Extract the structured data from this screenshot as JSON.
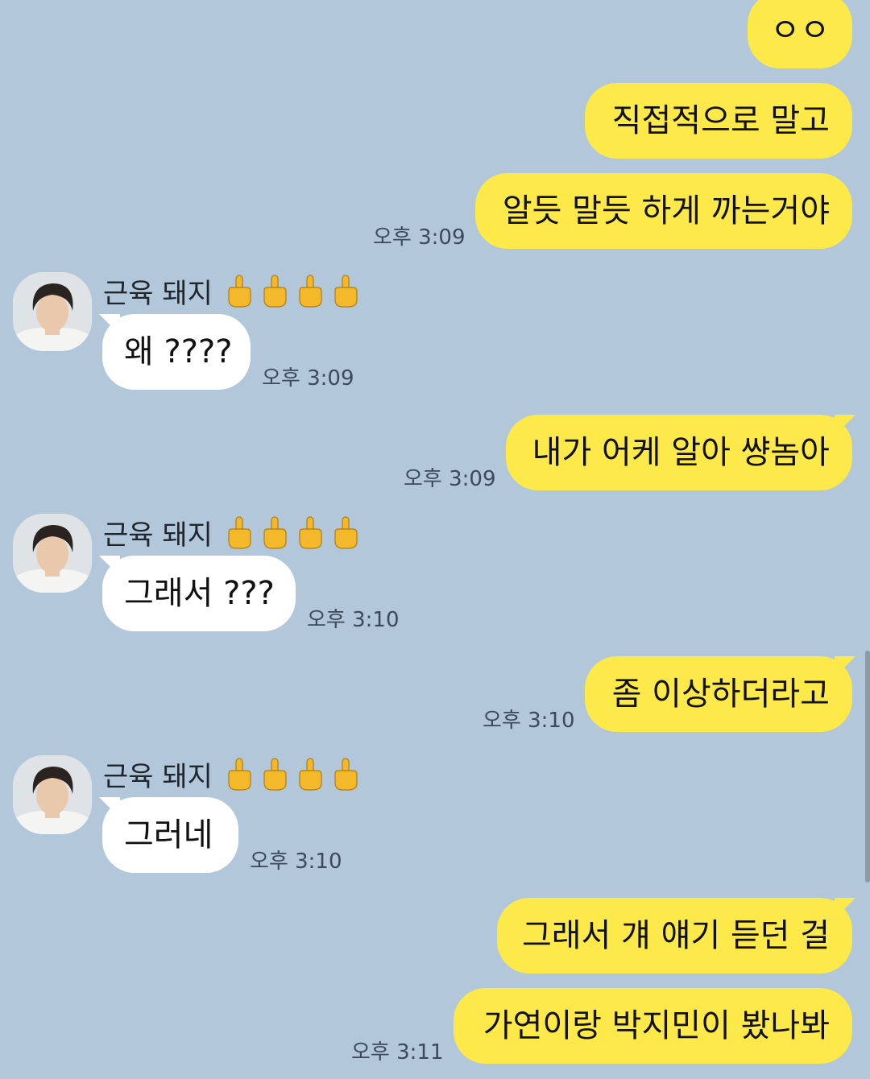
{
  "colors": {
    "background": "#b2c7da",
    "my_bubble": "#fee94a",
    "their_bubble": "#ffffff",
    "timestamp_text": "#3b4a5a"
  },
  "contact": {
    "name": "근육 돼지",
    "name_icons": [
      "middle-finger-icon",
      "middle-finger-icon",
      "middle-finger-icon",
      "middle-finger-icon"
    ]
  },
  "messages": [
    {
      "from": "me",
      "text": "ㅇㅇ"
    },
    {
      "from": "me",
      "text": "직접적으로 말고"
    },
    {
      "from": "me",
      "text": "알듯 말듯 하게 까는거야",
      "time": "오후 3:09"
    },
    {
      "from": "them",
      "text": "왜 ????",
      "time": "오후 3:09"
    },
    {
      "from": "me",
      "text": "내가 어케 알아 썅놈아",
      "time": "오후 3:09"
    },
    {
      "from": "them",
      "text": "그래서 ???",
      "time": "오후 3:10"
    },
    {
      "from": "me",
      "text": "좀 이상하더라고",
      "time": "오후 3:10"
    },
    {
      "from": "them",
      "text": "그러네",
      "time": "오후 3:10"
    },
    {
      "from": "me",
      "text": "그래서 걔 얘기 듣던 걸"
    },
    {
      "from": "me",
      "text": "가연이랑 박지민이 봤나봐",
      "time": "오후 3:11"
    }
  ]
}
